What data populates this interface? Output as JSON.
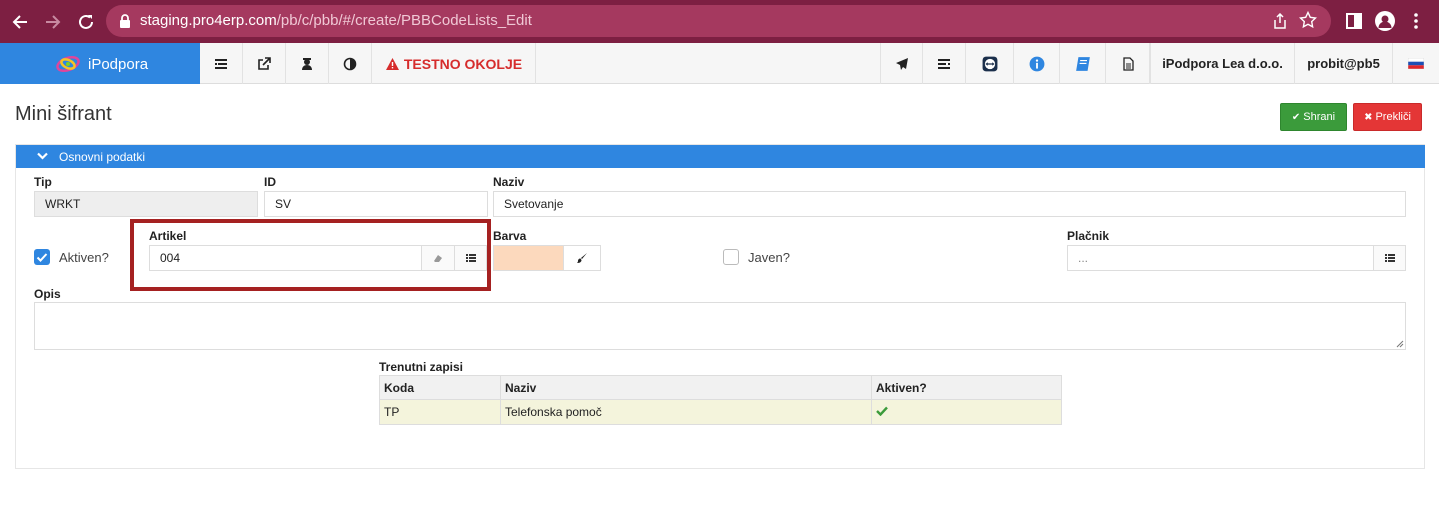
{
  "browser": {
    "url_host": "staging.pro4erp.com",
    "url_path": "/pb/c/pbb/#/create/PBBCodeLists_Edit"
  },
  "appnav": {
    "brand": "iPodpora",
    "warning": "TESTNO OKOLJE",
    "company": "iPodpora Lea d.o.o.",
    "user": "probit@pb5",
    "colors": {
      "brand": "#2f86e0",
      "warning": "#d62c2c"
    }
  },
  "page": {
    "title": "Mini šifrant",
    "save_label": "Shrani",
    "cancel_label": "Prekliči"
  },
  "panel": {
    "title": "Osnovni podatki",
    "fields": {
      "tip_label": "Tip",
      "tip_value": "WRKT",
      "id_label": "ID",
      "id_value": "SV",
      "naziv_label": "Naziv",
      "naziv_value": "Svetovanje",
      "aktiven_label": "Aktiven?",
      "aktiven_checked": true,
      "artikel_label": "Artikel",
      "artikel_value": "004",
      "barva_label": "Barva",
      "barva_color": "#fcd9bd",
      "javen_label": "Javen?",
      "javen_checked": false,
      "placnik_label": "Plačnik",
      "placnik_placeholder": "...",
      "opis_label": "Opis"
    }
  },
  "records": {
    "title": "Trenutni zapisi",
    "columns": [
      "Koda",
      "Naziv",
      "Aktiven?"
    ],
    "rows": [
      {
        "koda": "TP",
        "naziv": "Telefonska pomoč",
        "aktiven": true
      }
    ]
  }
}
